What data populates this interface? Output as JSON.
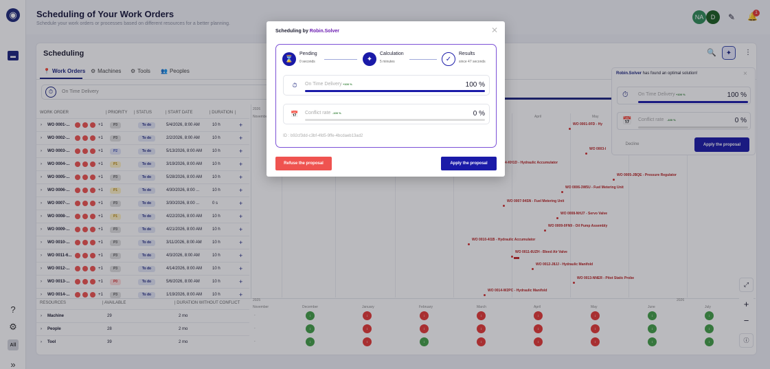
{
  "header": {
    "title": "Scheduling of Your Work Orders",
    "subtitle": "Schedule your work orders or processes based on different resources for a better planning.",
    "avatar1": "NA",
    "avatar2": "D",
    "notif_count": "1"
  },
  "rail": {
    "all_label": "All",
    "help_icon": "?",
    "settings_icon": "⚙",
    "expand_icon": "»"
  },
  "panel": {
    "title": "Scheduling",
    "tabs": [
      {
        "label": "Work Orders"
      },
      {
        "label": "Machines"
      },
      {
        "label": "Tools"
      },
      {
        "label": "Peoples"
      }
    ],
    "filter_label": "On Time Delivery"
  },
  "table": {
    "headers": [
      "WORK ORDER",
      "| PRIORITY",
      "| STATUS",
      "| START DATE",
      "| DURATION",
      "|"
    ],
    "rows": [
      {
        "id": "WO 0001-...",
        "plus": "+1",
        "priority": "P3",
        "status": "To do",
        "start": "5/4/2026, 8:00 AM",
        "duration": "10 h"
      },
      {
        "id": "WO 0002-...",
        "plus": "+1",
        "priority": "P3",
        "status": "To do",
        "start": "2/2/2026, 8:00 AM",
        "duration": "10 h"
      },
      {
        "id": "WO 0003-...",
        "plus": "+1",
        "priority": "P2",
        "status": "To do",
        "start": "5/13/2026, 8:00 AM",
        "duration": "10 h"
      },
      {
        "id": "WO 0004-...",
        "plus": "+1",
        "priority": "P1",
        "status": "To do",
        "start": "3/19/2026, 8:00 AM",
        "duration": "10 h"
      },
      {
        "id": "WO 0005-...",
        "plus": "+1",
        "priority": "P3",
        "status": "To do",
        "start": "5/28/2026, 8:00 AM",
        "duration": "10 h"
      },
      {
        "id": "WO 0006-...",
        "plus": "+1",
        "priority": "P1",
        "status": "To do",
        "start": "4/30/2026, 8:00 ...",
        "duration": "10 h"
      },
      {
        "id": "WO 0007-...",
        "plus": "+1",
        "priority": "P3",
        "status": "To do",
        "start": "3/30/2026, 8:00 ...",
        "duration": "0 s"
      },
      {
        "id": "WO 0008-...",
        "plus": "+1",
        "priority": "P1",
        "status": "To do",
        "start": "4/22/2026, 8:00 AM",
        "duration": "10 h"
      },
      {
        "id": "WO 0009-...",
        "plus": "+1",
        "priority": "P3",
        "status": "To do",
        "start": "4/21/2026, 8:00 AM",
        "duration": "10 h"
      },
      {
        "id": "WO 0010-...",
        "plus": "+1",
        "priority": "P3",
        "status": "To do",
        "start": "3/11/2026, 8:00 AM",
        "duration": "10 h"
      },
      {
        "id": "WO 0011-6...",
        "plus": "+1",
        "priority": "P3",
        "status": "To do",
        "start": "4/3/2026, 8:00 AM",
        "duration": "10 h"
      },
      {
        "id": "WO 0012-...",
        "plus": "+1",
        "priority": "P3",
        "status": "To do",
        "start": "4/14/2026, 8:00 AM",
        "duration": "10 h"
      },
      {
        "id": "WO 0013-...",
        "plus": "+1",
        "priority": "P0",
        "status": "To do",
        "start": "5/6/2026, 8:00 AM",
        "duration": "10 h"
      },
      {
        "id": "WO 0014-...",
        "plus": "+1",
        "priority": "P3",
        "status": "To do",
        "start": "1/19/2026, 8:00 AM",
        "duration": "10 h"
      }
    ]
  },
  "gantt": {
    "year_top": "2026",
    "months_top": [
      "November",
      "April",
      "May"
    ],
    "labels": [
      "WO 0001-0FD - Hy",
      "WO 0003-I",
      "4-KH1D - Hydraulic Accumulator",
      "WO 0005-JBQE - Pressure Regulator",
      "WO 0006-3W5U - Fuel Metering Unit",
      "WO 0007-94SN - Fuel Metering Unit",
      "WO 0008-NHJ7 - Servo Valve",
      "WO 0009-0FN9 - Oil Pump Assembly",
      "WO 0010-4I1B - Hydraulic Accumulator",
      "WO 0011-6UZH - Bleed Air Valve",
      "WO 0012-J8JJ - Hydraulic Manifold",
      "WO 0013-NNER - Pitot Static Probe",
      "WO 0014-W2PC - Hydraulic Manifold"
    ]
  },
  "resources": {
    "headers": [
      "RESOURCES",
      "| AVAILABLE",
      "| DURATION WITHOUT CONFLICT"
    ],
    "rows": [
      {
        "name": "Machine",
        "available": "29",
        "duration": "2 mo"
      },
      {
        "name": "People",
        "available": "28",
        "duration": "2 mo"
      },
      {
        "name": "Tool",
        "available": "39",
        "duration": "2 mo"
      }
    ],
    "year_left": "2025",
    "year_right": "2026",
    "months": [
      "November",
      "December",
      "January",
      "February",
      "March",
      "April",
      "May",
      "June",
      "July"
    ],
    "dash": "-"
  },
  "side_panel": {
    "brand": "Robin.Solver",
    "message": " has found an optimal solution!",
    "otd_label": "On Time Delivery",
    "otd_pct": "+100 %",
    "otd_value": "100 %",
    "otd_fill": 1.0,
    "conflict_label": "Conflict rate",
    "conflict_pct": "-100 %",
    "conflict_value": "0 %",
    "conflict_fill": 0.0,
    "decline": "Decline",
    "apply": "Apply the proposal"
  },
  "modal": {
    "title_prefix": "Scheduling by ",
    "brand": "Robin.Solver",
    "steps": [
      {
        "title": "Pending",
        "sub": "0 seconds"
      },
      {
        "title": "Calculation",
        "sub": "5 minutes"
      },
      {
        "title": "Results",
        "sub": "since 47 seconds"
      }
    ],
    "otd_label": "On Time Delivery",
    "otd_pct": "+100 %",
    "otd_value": "100 %",
    "otd_fill": 1.0,
    "conflict_label": "Conflict rate",
    "conflict_pct": "-100 %",
    "conflict_value": "0 %",
    "conflict_fill": 0.0,
    "id": "ID : b92cf3dd-c3bf-4fd5-9ffe-4bcdaeb13ad2",
    "refuse": "Refuse the proposal",
    "apply": "Apply the proposal"
  },
  "colors": {
    "primary": "#1a1aa8",
    "danger": "#ef5350",
    "brand_purple": "#6a1bb0",
    "success": "#2e7d32"
  }
}
